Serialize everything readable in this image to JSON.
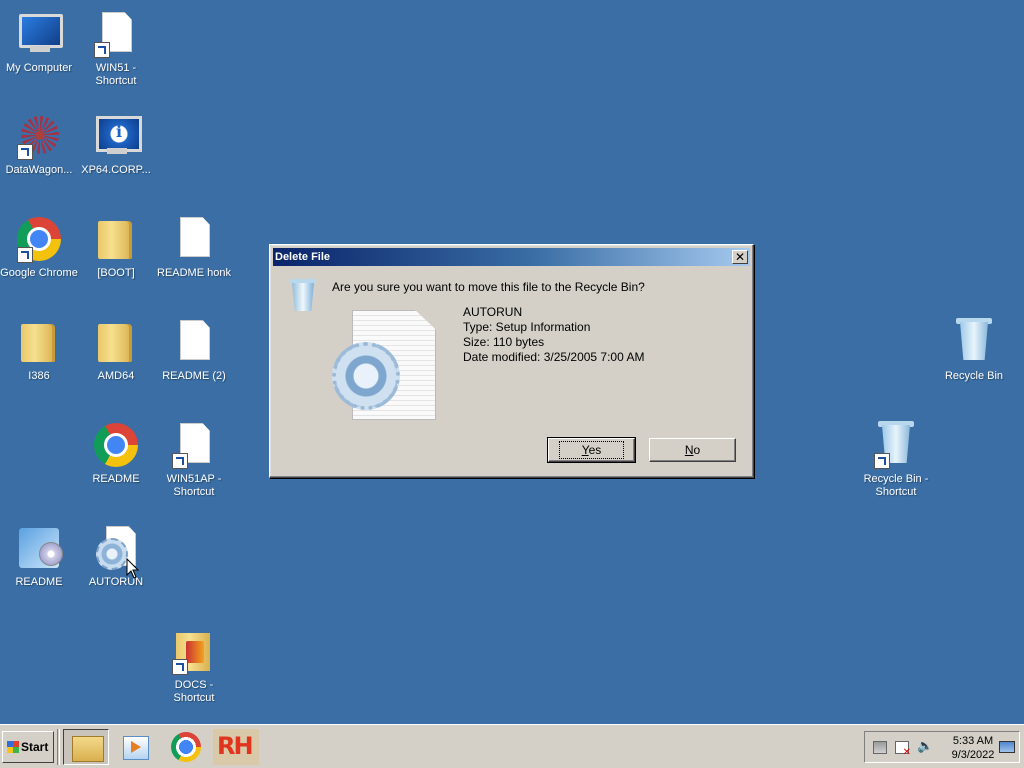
{
  "desktop": {
    "icons": [
      {
        "id": "my-computer",
        "label": "My Computer"
      },
      {
        "id": "win51-shortcut",
        "label": "WIN51 - Shortcut"
      },
      {
        "id": "datawagon",
        "label": "DataWagon..."
      },
      {
        "id": "xp64",
        "label": "XP64.CORP..."
      },
      {
        "id": "google-chrome",
        "label": "Google Chrome"
      },
      {
        "id": "boot",
        "label": "[BOOT]"
      },
      {
        "id": "readme-honk",
        "label": "README honk"
      },
      {
        "id": "i386",
        "label": "I386"
      },
      {
        "id": "amd64",
        "label": "AMD64"
      },
      {
        "id": "readme-2",
        "label": "README  (2)"
      },
      {
        "id": "readme-chrome",
        "label": "README"
      },
      {
        "id": "win51ap-shortcut",
        "label": "WIN51AP - Shortcut"
      },
      {
        "id": "readme-setup",
        "label": "README"
      },
      {
        "id": "autorun",
        "label": "AUTORUN"
      },
      {
        "id": "docs-shortcut",
        "label": "DOCS - Shortcut"
      },
      {
        "id": "recycle-bin",
        "label": "Recycle Bin"
      },
      {
        "id": "recycle-bin-shortcut",
        "label": "Recycle Bin - Shortcut"
      }
    ]
  },
  "dialog": {
    "title": "Delete File",
    "close_label": "✕",
    "question": "Are you sure you want to move this file to the Recycle Bin?",
    "file": {
      "name": "AUTORUN",
      "type": "Type: Setup Information",
      "size": "Size: 110 bytes",
      "modified": "Date modified: 3/25/2005 7:00 AM"
    },
    "yes_label_pre": "",
    "yes_label_u": "Y",
    "yes_label_post": "es",
    "no_label_pre": "",
    "no_label_u": "N",
    "no_label_post": "o"
  },
  "taskbar": {
    "start_label": "Start",
    "quick_launch": [
      "explorer-icon",
      "media-player-icon",
      "chrome-icon",
      "rh-icon"
    ],
    "rh_text": "RH",
    "clock": {
      "time": "5:33 AM",
      "date": "9/3/2022"
    }
  }
}
